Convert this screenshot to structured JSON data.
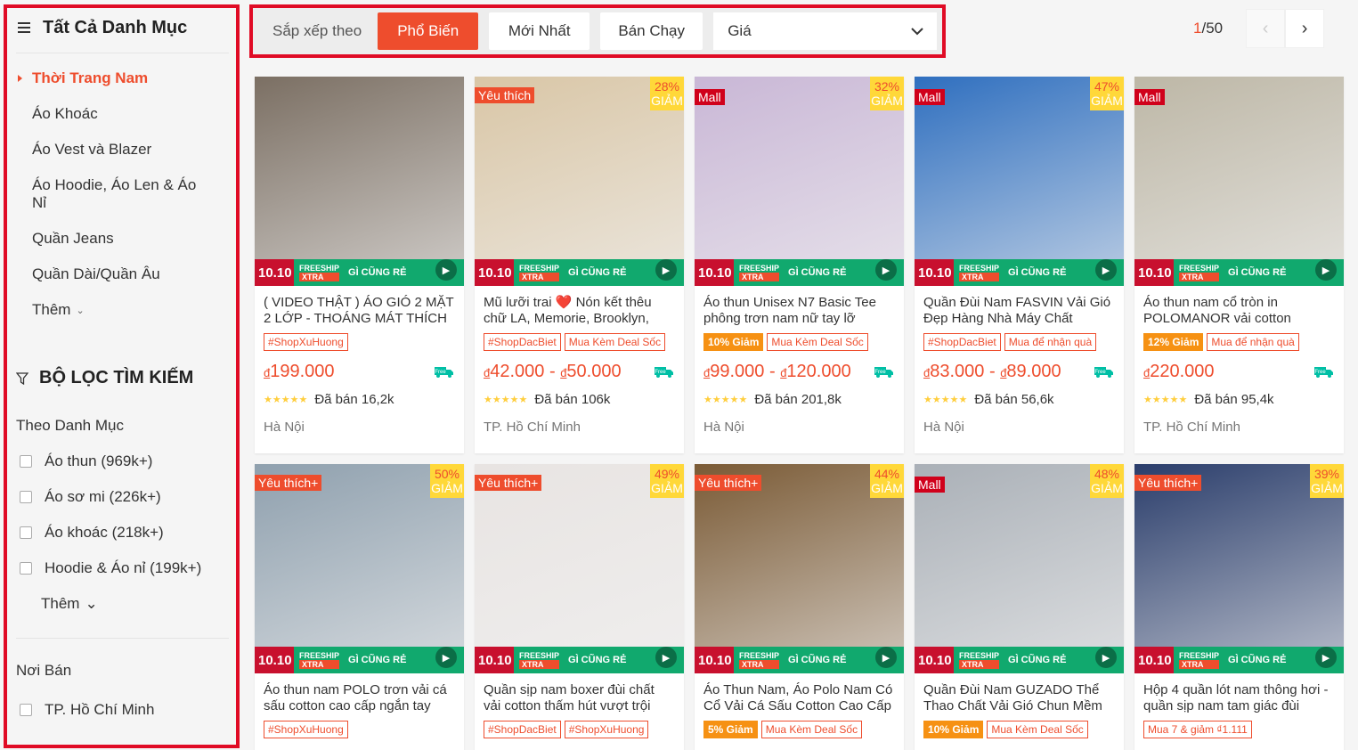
{
  "sidebar": {
    "title": "Tất Cả Danh Mục",
    "categories": [
      {
        "label": "Thời Trang Nam",
        "active": true
      },
      {
        "label": "Áo Khoác"
      },
      {
        "label": "Áo Vest và Blazer"
      },
      {
        "label": "Áo Hoodie, Áo Len & Áo Nỉ"
      },
      {
        "label": "Quần Jeans"
      },
      {
        "label": "Quần Dài/Quần Âu"
      }
    ],
    "more_label": "Thêm",
    "filter_title": "BỘ LỌC TÌM KIẾM",
    "by_category_label": "Theo Danh Mục",
    "filter_categories": [
      "Áo thun (969k+)",
      "Áo sơ mi (226k+)",
      "Áo khoác (218k+)",
      "Hoodie & Áo nỉ (199k+)"
    ],
    "filter_more_label": "Thêm",
    "place_label": "Nơi Bán",
    "places": [
      "TP. Hồ Chí Minh"
    ]
  },
  "sortbar": {
    "label": "Sắp xếp theo",
    "options": [
      "Phổ Biến",
      "Mới Nhất",
      "Bán Chạy"
    ],
    "active": "Phổ Biến",
    "price_select": "Giá"
  },
  "pagination": {
    "current": "1",
    "total": "/50"
  },
  "icons": {
    "menu": "list-icon",
    "filter": "filter-icon",
    "prev": "chevron-left-icon",
    "next": "chevron-right-icon",
    "play": "play-icon",
    "truck": "free-shipping-truck-icon"
  },
  "colors": {
    "accent": "#ee4d2d",
    "highlight_border": "#e00b25"
  },
  "products": [
    {
      "title": "( VIDEO THẬT ) ÁO GIÓ 2 MẶT 2 LỚP - THOÁNG MÁT THÍCH",
      "badge": "",
      "discount": "",
      "chips": [
        {
          "t": "#ShopXuHuong"
        }
      ],
      "price": "199.000",
      "price2": "",
      "sold": "Đã bán 16,2k",
      "location": "Hà Nội",
      "bg": "#7b6f63"
    },
    {
      "title": "Mũ lưỡi trai ❤️ Nón kết thêu chữ LA, Memorie, Brooklyn, Vintage",
      "badge": "Yêu thích",
      "discount": "28%",
      "chips": [
        {
          "t": "#ShopDacBiet"
        },
        {
          "t": "Mua Kèm Deal Sốc"
        }
      ],
      "price": "42.000",
      "price2": "50.000",
      "sold": "Đã bán 106k",
      "location": "TP. Hồ Chí Minh",
      "bg": "#d9c6a6"
    },
    {
      "title": "Áo thun Unisex N7 Basic Tee phông trơn nam nữ tay lỡ oversize",
      "badge": "Mall",
      "discount": "32%",
      "chips": [
        {
          "t": "10% Giảm",
          "fill": true
        },
        {
          "t": "Mua Kèm Deal Sốc"
        }
      ],
      "price": "99.000",
      "price2": "120.000",
      "sold": "Đã bán 201,8k",
      "location": "Hà Nội",
      "bg": "#c9b7d6"
    },
    {
      "title": "Quần Đùi Nam FASVIN Vải Gió Đẹp Hàng Nhà Máy Chất Lượng Cao",
      "badge": "Mall",
      "discount": "47%",
      "chips": [
        {
          "t": "#ShopDacBiet"
        },
        {
          "t": "Mua để nhận quà"
        }
      ],
      "price": "83.000",
      "price2": "89.000",
      "sold": "Đã bán 56,6k",
      "location": "Hà Nội",
      "bg": "#2f6fbf"
    },
    {
      "title": "Áo thun nam cổ tròn in POLOMANOR vải cotton Cosmo Tee",
      "badge": "Mall",
      "discount": "",
      "chips": [
        {
          "t": "12% Giảm",
          "fill": true
        },
        {
          "t": "Mua để nhận quà"
        }
      ],
      "price": "220.000",
      "price2": "",
      "sold": "Đã bán 95,4k",
      "location": "TP. Hồ Chí Minh",
      "bg": "#bdb7a6"
    },
    {
      "title": "Áo thun nam POLO trơn vải cá sấu cotton cao cấp ngắn tay cực sang",
      "badge": "Yêu thích+",
      "discount": "50%",
      "chips": [
        {
          "t": "#ShopXuHuong"
        }
      ],
      "price": "",
      "price2": "",
      "sold": "",
      "location": "",
      "bg": "#8fa0ae"
    },
    {
      "title": "Quần sịp nam boxer đùi chất vải cotton thấm hút vượt trội",
      "badge": "Yêu thích+",
      "discount": "49%",
      "chips": [
        {
          "t": "#ShopDacBiet"
        },
        {
          "t": "#ShopXuHuong"
        }
      ],
      "price": "",
      "price2": "",
      "sold": "",
      "location": "",
      "bg": "#e8e4e2"
    },
    {
      "title": "Áo Thun Nam, Áo Polo Nam Có Cổ Vải Cá Sấu Cotton Cao Cấp",
      "badge": "Yêu thích+",
      "discount": "44%",
      "chips": [
        {
          "t": "5% Giảm",
          "fill": true
        },
        {
          "t": "Mua Kèm Deal Sốc"
        }
      ],
      "price": "",
      "price2": "",
      "sold": "",
      "location": "",
      "bg": "#7a5a35"
    },
    {
      "title": "Quần Đùi Nam GUZADO Thể Thao Chất Vải Gió Chun Mềm Mại",
      "badge": "Mall",
      "discount": "48%",
      "chips": [
        {
          "t": "10% Giảm",
          "fill": true
        },
        {
          "t": "Mua Kèm Deal Sốc"
        }
      ],
      "price": "",
      "price2": "",
      "sold": "",
      "location": "",
      "bg": "#aab0b7"
    },
    {
      "title": "Hộp 4 quần lót nam thông hơi - quần sịp nam tam giác đùi nhiều màu",
      "badge": "Yêu thích+",
      "discount": "39%",
      "chips": [
        {
          "t": "Mua 7 & giảm ₫1.111"
        }
      ],
      "price": "",
      "price2": "",
      "sold": "",
      "location": "",
      "bg": "#2a3d6b"
    }
  ]
}
